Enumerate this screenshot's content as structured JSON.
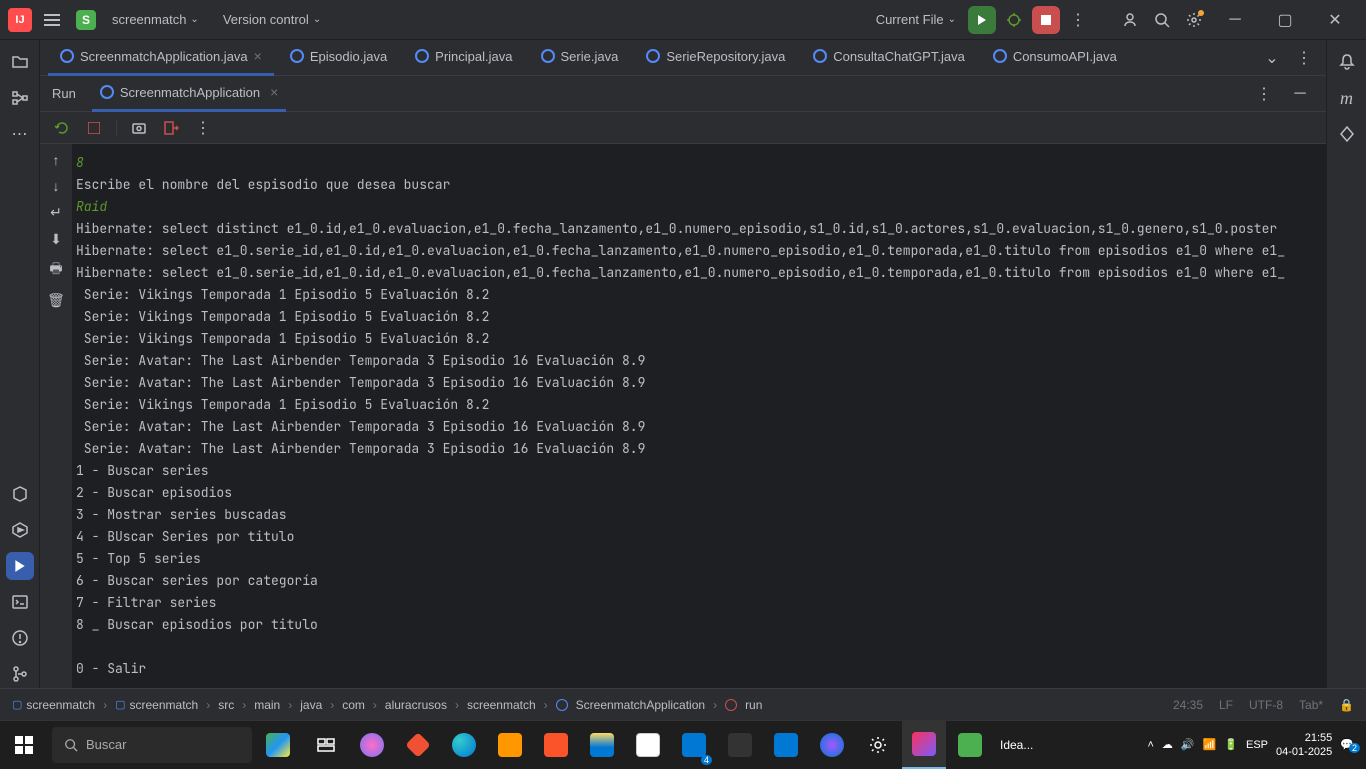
{
  "titlebar": {
    "project_name": "screenmatch",
    "vcs_label": "Version control",
    "run_config": "Current File"
  },
  "file_tabs": [
    {
      "name": "ScreenmatchApplication.java",
      "active": true,
      "closeable": true
    },
    {
      "name": "Episodio.java",
      "active": false,
      "closeable": false
    },
    {
      "name": "Principal.java",
      "active": false,
      "closeable": false
    },
    {
      "name": "Serie.java",
      "active": false,
      "closeable": false
    },
    {
      "name": "SerieRepository.java",
      "active": false,
      "closeable": false
    },
    {
      "name": "ConsultaChatGPT.java",
      "active": false,
      "closeable": false
    },
    {
      "name": "ConsumoAPI.java",
      "active": false,
      "closeable": false
    }
  ],
  "tool_window": {
    "label": "Run",
    "active_tab": "ScreenmatchApplication"
  },
  "console_output": {
    "input1": "8",
    "line1": "Escribe el nombre del espisodio que desea buscar",
    "input2": "Raid",
    "hibernate1": "Hibernate: select distinct e1_0.id,e1_0.evaluacion,e1_0.fecha_lanzamento,e1_0.numero_episodio,s1_0.id,s1_0.actores,s1_0.evaluacion,s1_0.genero,s1_0.poster",
    "hibernate2": "Hibernate: select e1_0.serie_id,e1_0.id,e1_0.evaluacion,e1_0.fecha_lanzamento,e1_0.numero_episodio,e1_0.temporada,e1_0.titulo from episodios e1_0 where e1_",
    "hibernate3": "Hibernate: select e1_0.serie_id,e1_0.id,e1_0.evaluacion,e1_0.fecha_lanzamento,e1_0.numero_episodio,e1_0.temporada,e1_0.titulo from episodios e1_0 where e1_",
    "r1": " Serie: Vikings Temporada 1 Episodio 5 Evaluación 8.2",
    "r2": " Serie: Vikings Temporada 1 Episodio 5 Evaluación 8.2",
    "r3": " Serie: Vikings Temporada 1 Episodio 5 Evaluación 8.2",
    "r4": " Serie: Avatar: The Last Airbender Temporada 3 Episodio 16 Evaluación 8.9",
    "r5": " Serie: Avatar: The Last Airbender Temporada 3 Episodio 16 Evaluación 8.9",
    "r6": " Serie: Vikings Temporada 1 Episodio 5 Evaluación 8.2",
    "r7": " Serie: Avatar: The Last Airbender Temporada 3 Episodio 16 Evaluación 8.9",
    "r8": " Serie: Avatar: The Last Airbender Temporada 3 Episodio 16 Evaluación 8.9",
    "m1": "1 - Buscar series",
    "m2": "2 - Buscar episodios",
    "m3": "3 - Mostrar series buscadas",
    "m4": "4 - BUscar Series por titulo",
    "m5": "5 - Top 5 series",
    "m6": "6 - Buscar series por categoría",
    "m7": "7 - Filtrar series",
    "m8": "8 _ Buscar episodios por titulo",
    "m0": "0 - Salir"
  },
  "breadcrumb": {
    "items": [
      "screenmatch",
      "screenmatch",
      "src",
      "main",
      "java",
      "com",
      "aluracrusos",
      "screenmatch",
      "ScreenmatchApplication",
      "run"
    ]
  },
  "status_bar": {
    "cursor": "24:35",
    "line_ending": "LF",
    "encoding": "UTF-8",
    "indent": "Tab*"
  },
  "taskbar": {
    "search_placeholder": "Buscar",
    "idea_label": "Idea...",
    "lang": "ESP",
    "time": "21:55",
    "date": "04-01-2025",
    "mail_badge": "4",
    "notif_badge": "2"
  }
}
